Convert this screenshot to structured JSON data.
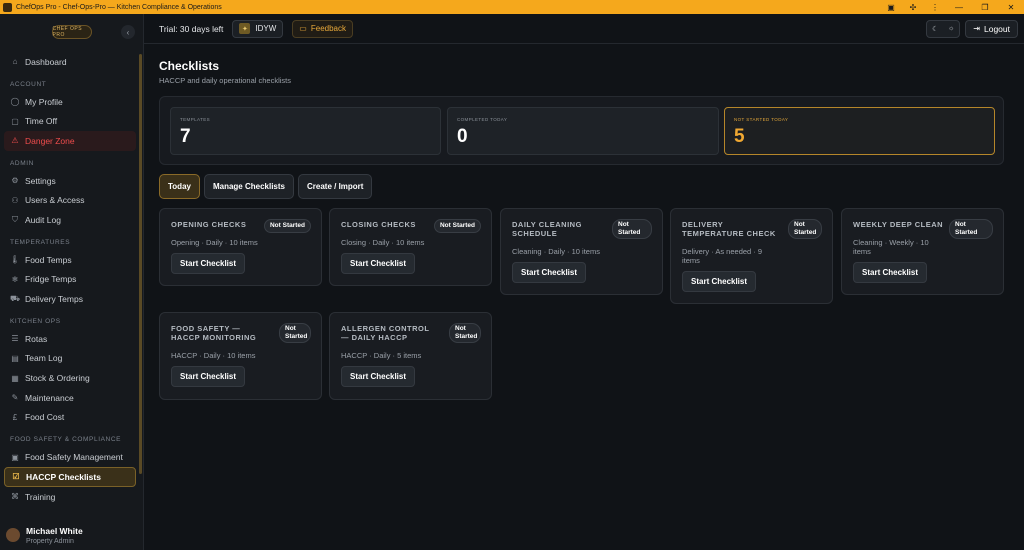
{
  "window": {
    "title": "ChefOps Pro - Chef-Ops-Pro — Kitchen Compliance & Operations"
  },
  "sidebar": {
    "logo_text": "CHEF OPS PRO",
    "items": {
      "dashboard": "Dashboard",
      "my_profile": "My Profile",
      "time_off": "Time Off",
      "danger_zone": "Danger Zone",
      "settings": "Settings",
      "users_access": "Users & Access",
      "audit_log": "Audit Log",
      "food_temps": "Food Temps",
      "fridge_temps": "Fridge Temps",
      "delivery_temps": "Delivery Temps",
      "rotas": "Rotas",
      "team_log": "Team Log",
      "stock_ordering": "Stock & Ordering",
      "maintenance": "Maintenance",
      "food_cost": "Food Cost",
      "food_safety_management": "Food Safety Management",
      "haccp_checklists": "HACCP Checklists",
      "training": "Training"
    },
    "sections": {
      "account": "ACCOUNT",
      "admin": "ADMIN",
      "temperatures": "TEMPERATURES",
      "kitchen_ops": "KITCHEN OPS",
      "food_safety": "FOOD SAFETY & COMPLIANCE"
    },
    "user": {
      "name": "Michael White",
      "role": "Property Admin"
    }
  },
  "topbar": {
    "trial": "Trial: 30 days left",
    "badge": "IDYW",
    "feedback": "Feedback",
    "logout": "Logout"
  },
  "page": {
    "title": "Checklists",
    "subtitle": "HACCP and daily operational checklists"
  },
  "stats": {
    "templates": {
      "label": "TEMPLATES",
      "value": "7"
    },
    "completed": {
      "label": "COMPLETED TODAY",
      "value": "0"
    },
    "not_started": {
      "label": "NOT STARTED TODAY",
      "value": "5"
    }
  },
  "tabs": {
    "today": "Today",
    "manage": "Manage Checklists",
    "create": "Create / Import"
  },
  "status_not_started": "Not Started",
  "start_label": "Start Checklist",
  "cards": [
    {
      "title": "OPENING CHECKS",
      "meta": "Opening · Daily · 10 items"
    },
    {
      "title": "CLOSING CHECKS",
      "meta": "Closing · Daily · 10 items"
    },
    {
      "title": "DAILY CLEANING SCHEDULE",
      "meta": "Cleaning · Daily · 10 items"
    },
    {
      "title": "DELIVERY TEMPERATURE CHECK",
      "meta": "Delivery · As needed · 9 items"
    },
    {
      "title": "WEEKLY DEEP CLEAN",
      "meta": "Cleaning · Weekly · 10 items"
    },
    {
      "title": "FOOD SAFETY — HACCP MONITORING",
      "meta": "HACCP · Daily · 10 items"
    },
    {
      "title": "ALLERGEN CONTROL — DAILY HACCP",
      "meta": "HACCP · Daily · 5 items"
    }
  ],
  "colors": {
    "accent": "#f5a81c",
    "danger": "#ef4c4c",
    "background": "#101317"
  }
}
